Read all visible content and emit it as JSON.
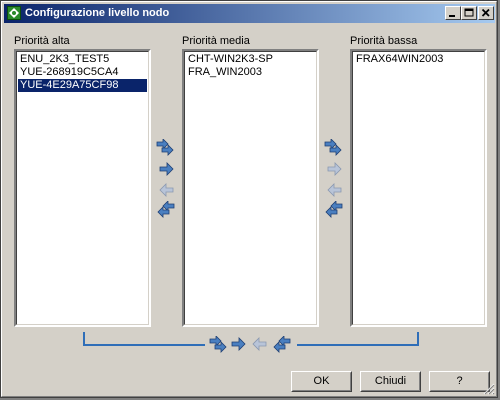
{
  "window": {
    "title": "Configurazione livello nodo",
    "minimize_icon": "minimize-icon",
    "maximize_icon": "maximize-icon",
    "close_icon": "close-icon"
  },
  "lists": [
    {
      "label": "Priorità alta",
      "items": [
        "ENU_2K3_TEST5",
        "YUE-268919C5CA4",
        "YUE-4E29A75CF98"
      ],
      "selected_index": 2
    },
    {
      "label": "Priorità media",
      "items": [
        "CHT-WIN2K3-SP",
        "FRA_WIN2003"
      ],
      "selected_index": null
    },
    {
      "label": "Priorità bassa",
      "items": [
        "FRAX64WIN2003"
      ],
      "selected_index": null
    }
  ],
  "arrow_groups": {
    "left_vertical": [
      "move-all-right-icon",
      "move-right-icon",
      "move-left-icon",
      "move-all-left-icon"
    ],
    "right_vertical": [
      "move-all-right-icon",
      "move-right-icon",
      "move-left-icon",
      "move-all-left-icon"
    ],
    "bottom_horizontal": [
      "move-all-right-icon",
      "move-right-icon",
      "move-left-icon",
      "move-all-left-icon"
    ]
  },
  "buttons": {
    "ok": "OK",
    "close": "Chiudi",
    "help": "?"
  },
  "colors": {
    "title_bar_start": "#0a246a",
    "title_bar_end": "#a6caf0",
    "selection": "#0a246a",
    "connector": "#2f6eb8",
    "arrow_enabled": "#4a7fc0",
    "arrow_disabled": "#b8c4d8"
  }
}
